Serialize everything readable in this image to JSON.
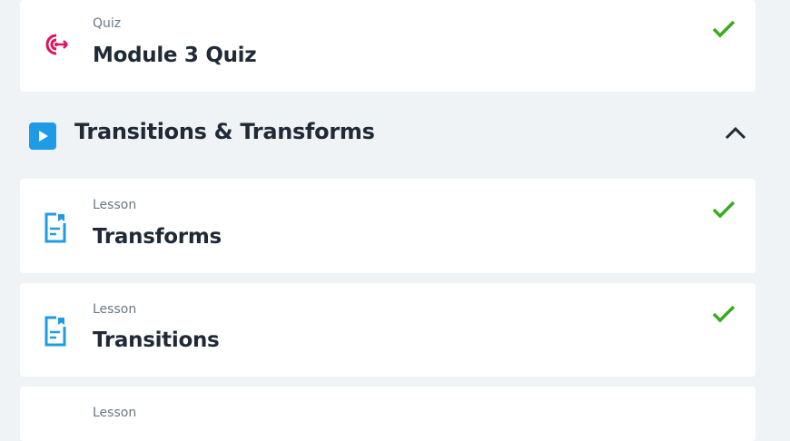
{
  "items_top": [
    {
      "type": "Quiz",
      "title": "Module 3 Quiz",
      "icon": "target-icon",
      "completed": true
    }
  ],
  "section": {
    "title": "Transitions & Transforms",
    "icon": "play-icon",
    "expanded": true,
    "toggle_icon": "chevron-up-icon"
  },
  "lessons": [
    {
      "type": "Lesson",
      "title": "Transforms",
      "icon": "document-icon",
      "completed": true
    },
    {
      "type": "Lesson",
      "title": "Transitions",
      "icon": "document-icon",
      "completed": true
    },
    {
      "type": "Lesson",
      "title": "",
      "icon": "document-icon",
      "completed": false
    }
  ],
  "colors": {
    "check": "#3aaa1f",
    "quiz_icon": "#e0115f",
    "lesson_icon": "#1f9be6",
    "section_icon_bg": "#1f9be6"
  }
}
